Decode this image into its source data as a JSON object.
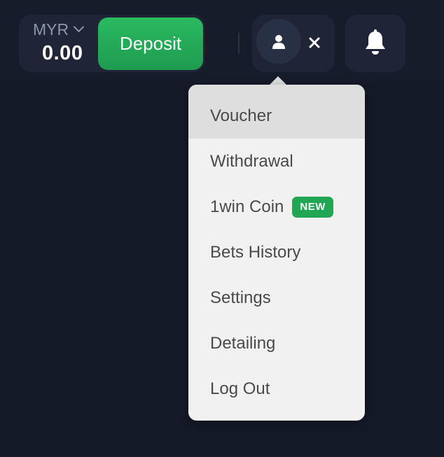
{
  "header": {
    "currency": "MYR",
    "balance": "0.00",
    "deposit_label": "Deposit"
  },
  "icons": {
    "currency_chevron": "chevron-down-icon",
    "avatar": "user-icon",
    "close": "close-icon",
    "notifications": "bell-icon"
  },
  "colors": {
    "background": "#151a28",
    "deposit_button": "#2aba61",
    "menu_background": "#f1f1f1",
    "menu_hover": "#dedede",
    "new_badge": "#21a653"
  },
  "menu": {
    "items": [
      {
        "label": "Voucher",
        "highlighted": true
      },
      {
        "label": "Withdrawal"
      },
      {
        "label": "1win Coin",
        "badge": "NEW"
      },
      {
        "label": "Bets History"
      },
      {
        "label": "Settings"
      },
      {
        "label": "Detailing"
      },
      {
        "label": "Log Out"
      }
    ]
  }
}
